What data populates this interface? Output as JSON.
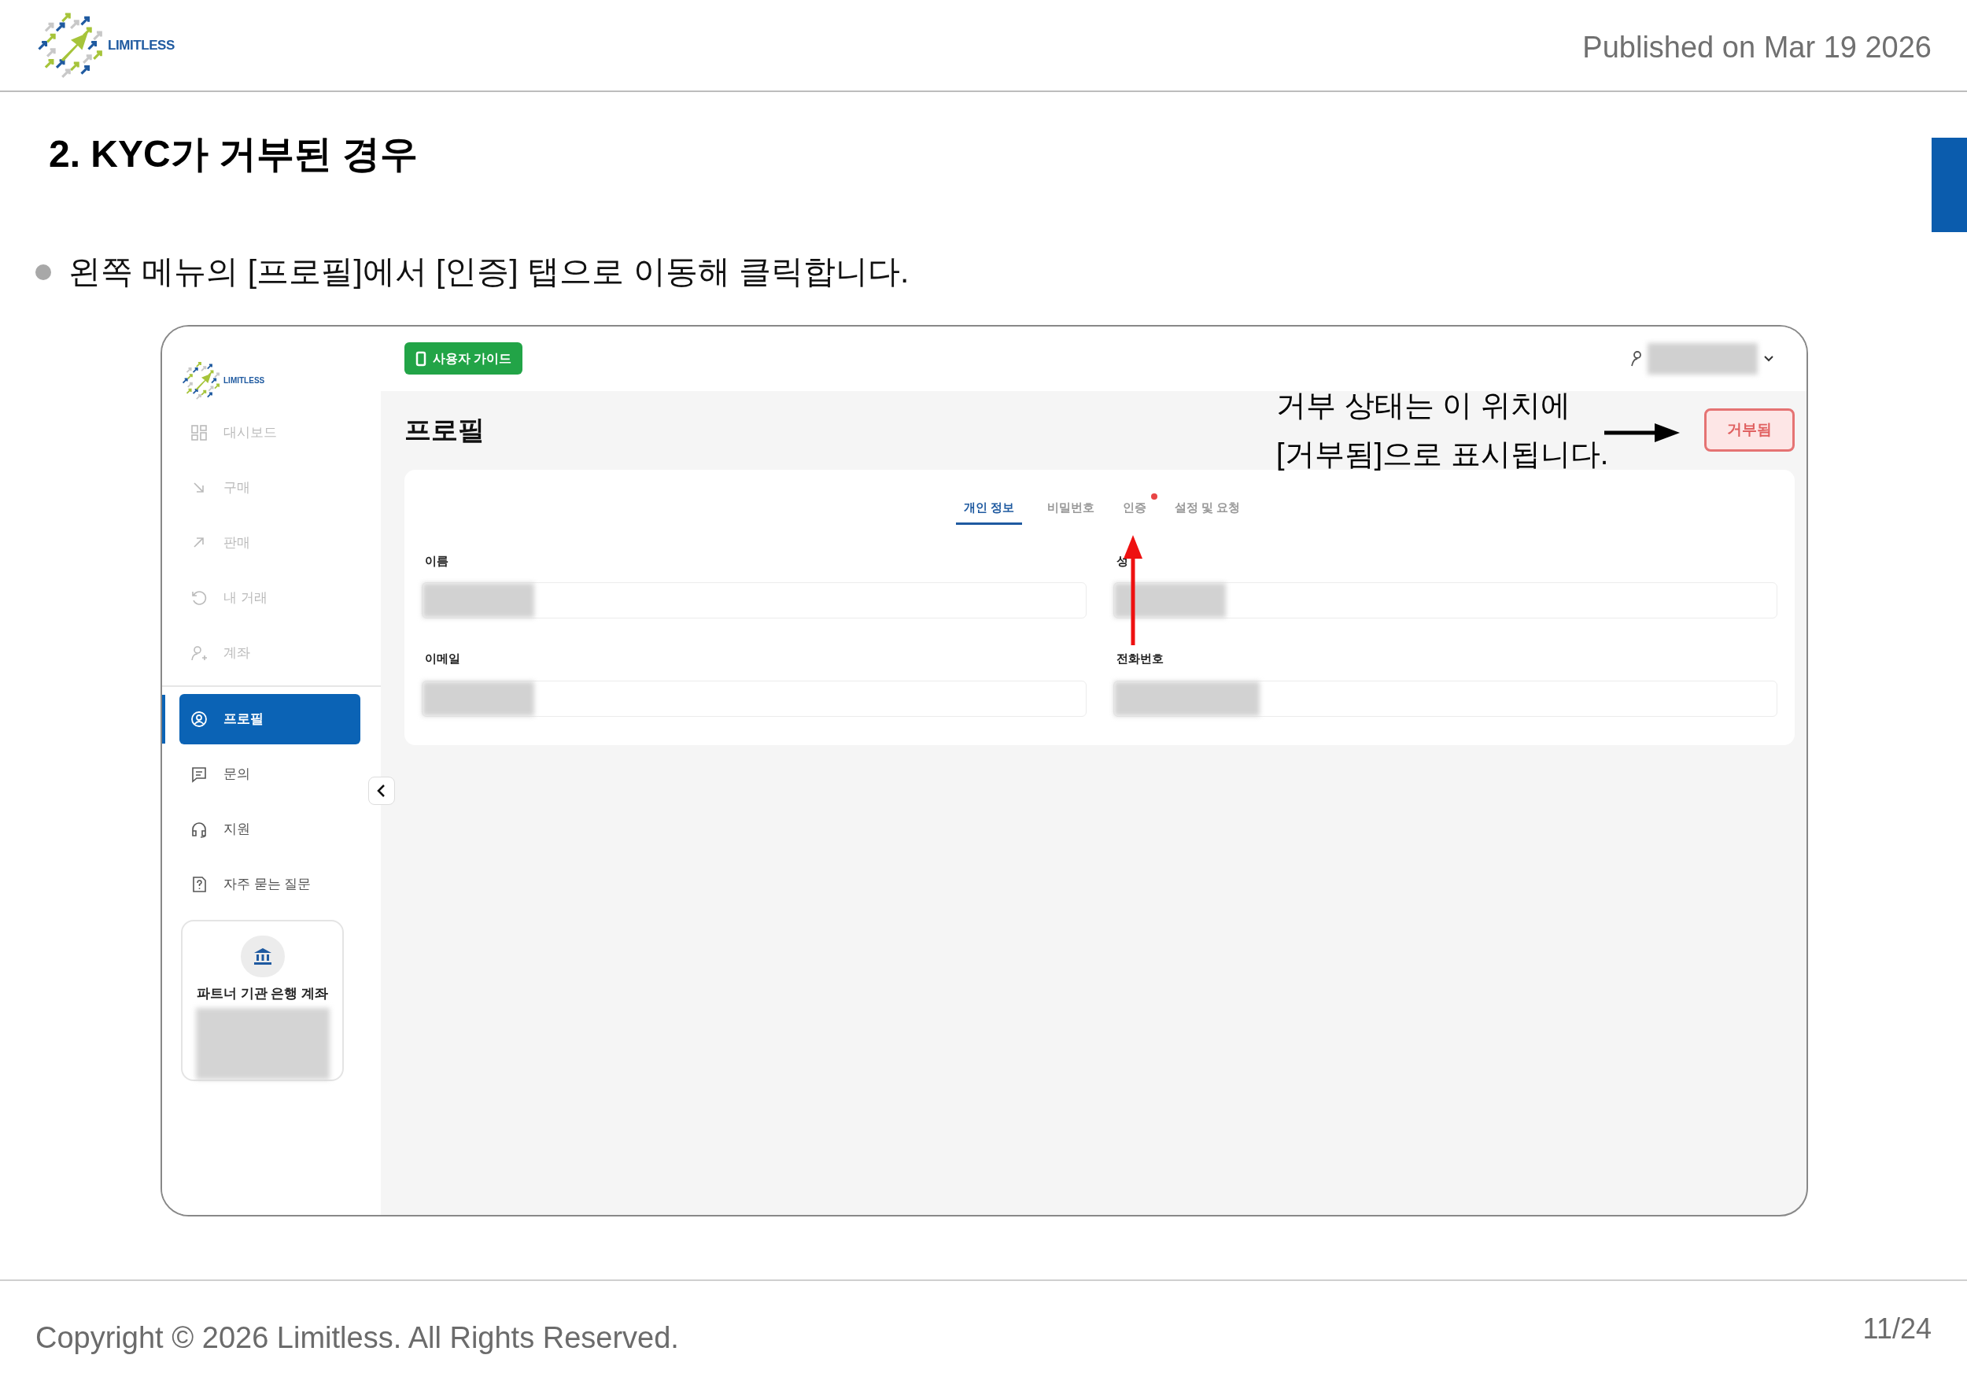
{
  "header": {
    "logo_text": "LIMITLESS",
    "published": "Published on Mar 19 2026"
  },
  "section_title": "2. KYC가 거부된 경우",
  "bullets": [
    "왼쪽 메뉴의 [프로필]에서 [인증] 탭으로 이동해 클릭합니다."
  ],
  "app": {
    "logo_text": "LIMITLESS",
    "sidebar": {
      "groups": [
        [
          {
            "label": "대시보드",
            "disabled": true,
            "selected": false
          },
          {
            "label": "구매",
            "disabled": true,
            "selected": false
          },
          {
            "label": "판매",
            "disabled": true,
            "selected": false
          },
          {
            "label": "내 거래",
            "disabled": true,
            "selected": false
          },
          {
            "label": "계좌",
            "disabled": true,
            "selected": false
          }
        ],
        [
          {
            "label": "프로필",
            "disabled": false,
            "selected": true
          },
          {
            "label": "문의",
            "disabled": false,
            "selected": false
          },
          {
            "label": "지원",
            "disabled": false,
            "selected": false
          },
          {
            "label": "자주 묻는 질문",
            "disabled": false,
            "selected": false
          }
        ]
      ],
      "partner_card": {
        "title": "파트너 기관 은행 계좌"
      }
    },
    "topbar": {
      "guide_button": "사용자 가이드"
    },
    "page_title": "프로필",
    "status_badge": "거부됨",
    "tabs": [
      {
        "label": "개인 정보",
        "selected": true,
        "notification": false
      },
      {
        "label": "비밀번호",
        "selected": false,
        "notification": false
      },
      {
        "label": "인증",
        "selected": false,
        "notification": true
      },
      {
        "label": "설정 및 요청",
        "selected": false,
        "notification": false
      }
    ],
    "fields": [
      {
        "label": "이름"
      },
      {
        "label": "성"
      },
      {
        "label": "이메일"
      },
      {
        "label": "전화번호"
      }
    ]
  },
  "annotation": {
    "lines": [
      "거부 상태는 이 위치에",
      "[거부됨]으로 표시됩니다."
    ]
  },
  "footer": {
    "copyright": "Copyright © 2026 Limitless. All Rights Reserved.",
    "page": "11/24"
  }
}
